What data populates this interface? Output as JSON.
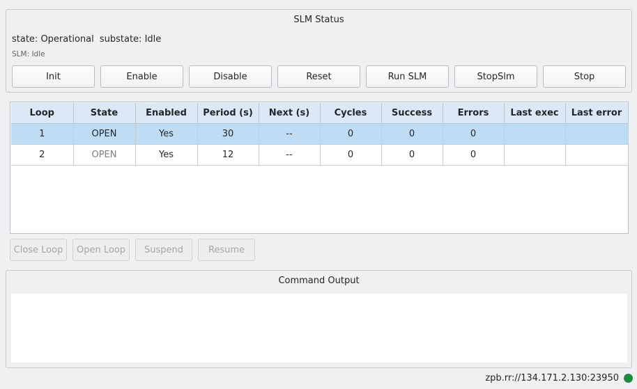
{
  "slm_status": {
    "title": "SLM Status",
    "state": "state: Operational",
    "substate": "substate: Idle",
    "slm_line": "SLM: Idle",
    "buttons": [
      "Init",
      "Enable",
      "Disable",
      "Reset",
      "Run SLM",
      "StopSlm",
      "Stop"
    ]
  },
  "loops_table": {
    "headers": [
      "Loop",
      "State",
      "Enabled",
      "Period (s)",
      "Next (s)",
      "Cycles",
      "Success",
      "Errors",
      "Last exec",
      "Last error"
    ],
    "rows": [
      [
        "1",
        "OPEN",
        "Yes",
        "30",
        "--",
        "0",
        "0",
        "0",
        "",
        ""
      ],
      [
        "2",
        "OPEN",
        "Yes",
        "12",
        "--",
        "0",
        "0",
        "0",
        "",
        ""
      ]
    ],
    "selected_row": 0
  },
  "loop_buttons": [
    "Close Loop",
    "Open Loop",
    "Suspend",
    "Resume"
  ],
  "command_output": {
    "title": "Command Output",
    "text": ""
  },
  "status_bar": {
    "connection": "zpb.rr://134.171.2.130:23950",
    "indicator_color": "#1e8a3c"
  }
}
